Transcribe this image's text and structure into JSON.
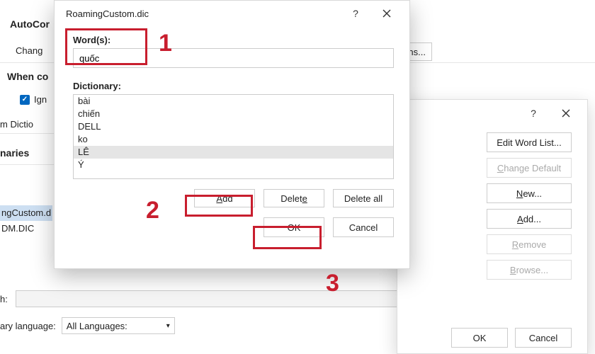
{
  "bg": {
    "autocorrect_label": "AutoCor",
    "change_label": "Chang",
    "ns_button": "ns...",
    "when_label": "When co",
    "ignore_label": "Ign",
    "dict_label_frag": "m Dictio",
    "naries_label": "naries",
    "row1": "ngCustom.d",
    "row2": "DM.DIC",
    "path_label": "h:",
    "lang_label": "ary language:",
    "lang_value": "All Languages:"
  },
  "cdict": {
    "edit_word_list": "Edit Word List...",
    "change_default": "Change Default",
    "new": "New...",
    "add": "Add...",
    "remove": "Remove",
    "browse": "Browse...",
    "ok": "OK",
    "cancel": "Cancel"
  },
  "dlg": {
    "title": "RoamingCustom.dic",
    "word_label": "Word(s):",
    "word_value": "quốc",
    "dict_label": "Dictionary:",
    "items": {
      "0": "bài",
      "1": "chiến",
      "2": "DELL",
      "3": "ko",
      "4": "LÊ",
      "5": "Ý"
    },
    "add": "Add",
    "delete": "Delete",
    "delete_all": "Delete all",
    "ok": "OK",
    "cancel": "Cancel"
  },
  "annot": {
    "n1": "1",
    "n2": "2",
    "n3": "3"
  }
}
